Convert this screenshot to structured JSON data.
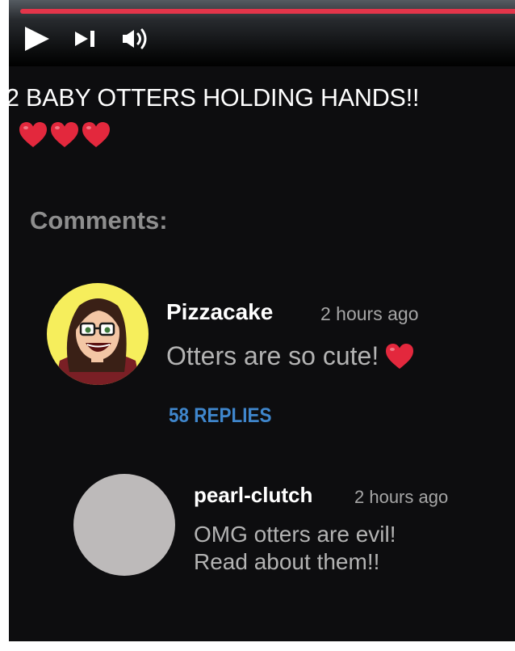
{
  "player": {
    "progress_color": "#e3354a",
    "controls": [
      "play-icon",
      "skip-next-icon",
      "volume-icon"
    ]
  },
  "video": {
    "title": "2 BABY OTTERS HOLDING HANDS!!",
    "title_emoji": [
      "heart-icon",
      "heart-icon",
      "heart-icon"
    ]
  },
  "comments": {
    "heading": "Comments:",
    "items": [
      {
        "author": "Pizzacake",
        "time": "2 hours ago",
        "text": "Otters are so cute!",
        "emoji": "heart-icon",
        "replies_label": "58 REPLIES"
      },
      {
        "author": "pearl-clutch",
        "time": "2 hours ago",
        "text_lines": [
          "OMG otters are evil!",
          "Read about them!!"
        ]
      }
    ]
  },
  "colors": {
    "background": "#0d0d0f",
    "heart": "#e3283d",
    "link": "#3f86cc",
    "avatar_ring": "#f6ee5c",
    "placeholder_avatar": "#bdbaba"
  }
}
